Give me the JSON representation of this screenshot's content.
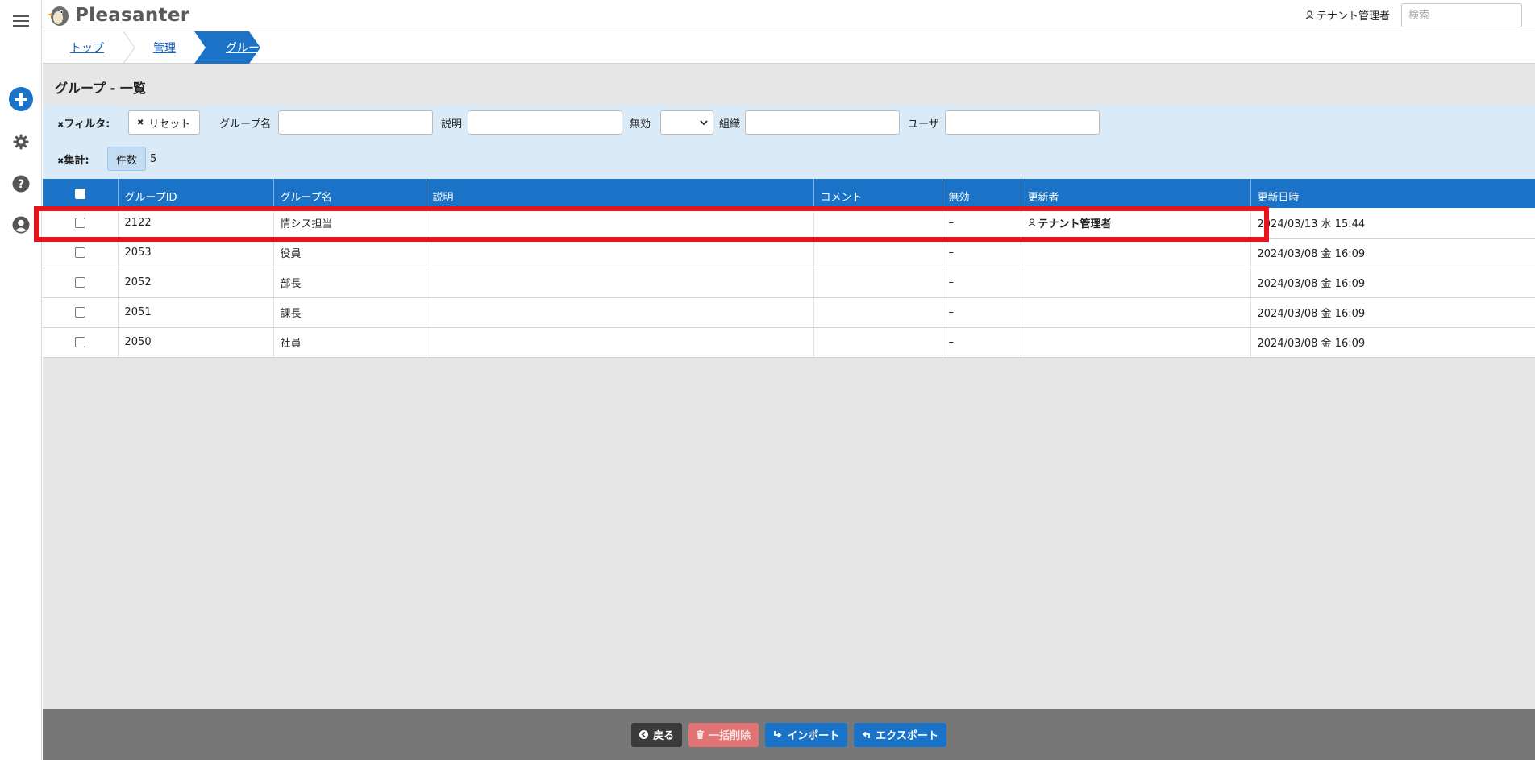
{
  "app": {
    "logo_text": "Pleasanter"
  },
  "header": {
    "user_name": "テナント管理者",
    "search_placeholder": "検索"
  },
  "breadcrumb": [
    {
      "label": "トップ"
    },
    {
      "label": "管理"
    },
    {
      "label": "グループ"
    }
  ],
  "page": {
    "title": "グループ - 一覧"
  },
  "filter": {
    "toggle_label": "フィルタ:",
    "reset_label": "リセット",
    "group_name_label": "グループ名",
    "description_label": "説明",
    "disabled_label": "無効",
    "organization_label": "組織",
    "user_label": "ユーザ"
  },
  "aggregate": {
    "toggle_label": "集計:",
    "count_label": "件数",
    "count_value": "5"
  },
  "table": {
    "headers": [
      "グループID",
      "グループ名",
      "説明",
      "コメント",
      "無効",
      "更新者",
      "更新日時"
    ],
    "rows": [
      {
        "id": "2122",
        "name": "情シス担当",
        "description": "",
        "comment": "",
        "disabled": "–",
        "updater": "テナント管理者",
        "updated": "2024/03/13 水 15:44"
      },
      {
        "id": "2053",
        "name": "役員",
        "description": "",
        "comment": "",
        "disabled": "–",
        "updater": "",
        "updated": "2024/03/08 金 16:09"
      },
      {
        "id": "2052",
        "name": "部長",
        "description": "",
        "comment": "",
        "disabled": "–",
        "updater": "",
        "updated": "2024/03/08 金 16:09"
      },
      {
        "id": "2051",
        "name": "課長",
        "description": "",
        "comment": "",
        "disabled": "–",
        "updater": "",
        "updated": "2024/03/08 金 16:09"
      },
      {
        "id": "2050",
        "name": "社員",
        "description": "",
        "comment": "",
        "disabled": "–",
        "updater": "",
        "updated": "2024/03/08 金 16:09"
      }
    ]
  },
  "footer": {
    "back_label": "戻る",
    "bulk_delete_label": "一括削除",
    "import_label": "インポート",
    "export_label": "エクスポート"
  },
  "colors": {
    "accent": "#1a73c7",
    "filter_bg": "#dbeaf7",
    "highlight": "#e8141c",
    "footer_bg": "#777777"
  }
}
